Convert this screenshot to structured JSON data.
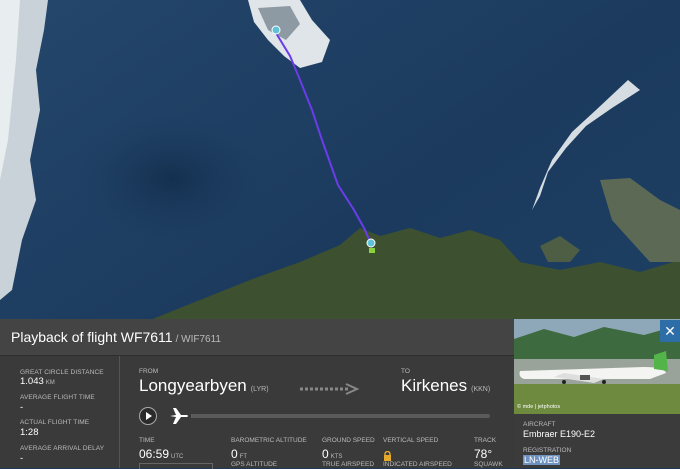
{
  "flight": {
    "title": "Playback of flight WF7611",
    "callsign": "/ WIF7611"
  },
  "stats": {
    "gcd_label": "GREAT CIRCLE DISTANCE",
    "gcd_value": "1.043",
    "gcd_unit": "KM",
    "avg_time_label": "AVERAGE FLIGHT TIME",
    "avg_time_value": "-",
    "actual_time_label": "ACTUAL FLIGHT TIME",
    "actual_time_value": "1:28",
    "avg_delay_label": "AVERAGE ARRIVAL DELAY",
    "avg_delay_value": "-"
  },
  "route": {
    "from_label": "FROM",
    "from_city": "Longyearbyen",
    "from_code": "(LYR)",
    "to_label": "TO",
    "to_city": "Kirkenes",
    "to_code": "(KKN)"
  },
  "metrics": {
    "time_label": "TIME",
    "time_value": "06:59",
    "time_unit": "UTC",
    "baro_label": "BAROMETRIC ALTITUDE",
    "baro_value": "0",
    "baro_unit": "FT",
    "gps_label": "GPS ALTITUDE",
    "gs_label": "GROUND SPEED",
    "gs_value": "0",
    "gs_unit": "KTS",
    "tas_label": "TRUE AIRSPEED",
    "vs_label": "VERTICAL SPEED",
    "ias_label": "INDICATED AIRSPEED",
    "track_label": "TRACK",
    "track_value": "78°",
    "squawk_label": "SQUAWK"
  },
  "aircraft": {
    "photo_credit": "© mde | jetphotos",
    "aircraft_label": "AIRCRAFT",
    "aircraft_value": "Embraer E190-E2",
    "registration_label": "REGISTRATION",
    "registration_value": "LN-WEB",
    "close_glyph": "✕"
  },
  "colors": {
    "route_line": "#6a3de8",
    "accent": "#2d6ea8"
  },
  "icons": [
    "plane-icon",
    "play-icon",
    "arrow-right-icon",
    "lock-icon",
    "close-icon",
    "departure-marker-icon",
    "arrival-marker-icon"
  ]
}
